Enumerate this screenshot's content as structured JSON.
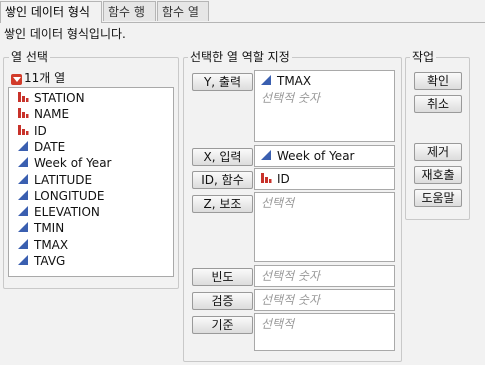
{
  "tabs": [
    {
      "label": "쌓인 데이터 형식"
    },
    {
      "label": "함수 행"
    },
    {
      "label": "함수 열"
    }
  ],
  "description": "쌓인 데이터 형식입니다.",
  "column_select": {
    "title": "열 선택",
    "count_label": "11개 열",
    "items": [
      {
        "label": "STATION",
        "type": "nominal"
      },
      {
        "label": "NAME",
        "type": "nominal"
      },
      {
        "label": "ID",
        "type": "nominal"
      },
      {
        "label": "DATE",
        "type": "continuous"
      },
      {
        "label": "Week of Year",
        "type": "continuous"
      },
      {
        "label": "LATITUDE",
        "type": "continuous"
      },
      {
        "label": "LONGITUDE",
        "type": "continuous"
      },
      {
        "label": "ELEVATION",
        "type": "continuous"
      },
      {
        "label": "TMIN",
        "type": "continuous"
      },
      {
        "label": "TMAX",
        "type": "continuous"
      },
      {
        "label": "TAVG",
        "type": "continuous"
      }
    ]
  },
  "roles": {
    "title": "선택한 열 역할 지정",
    "y": {
      "button": "Y, 출력",
      "value": "TMAX",
      "placeholder": "선택적 숫자"
    },
    "x": {
      "button": "X, 입력",
      "value": "Week of Year"
    },
    "id": {
      "button": "ID, 함수",
      "value": "ID"
    },
    "z": {
      "button": "Z, 보조",
      "placeholder": "선택적"
    },
    "freq": {
      "button": "빈도",
      "placeholder": "선택적 숫자"
    },
    "validation": {
      "button": "검증",
      "placeholder": "선택적 숫자"
    },
    "by": {
      "button": "기준",
      "placeholder": "선택적"
    }
  },
  "actions": {
    "title": "작업",
    "ok": "확인",
    "cancel": "취소",
    "remove": "제거",
    "recall": "재호출",
    "help": "도움말"
  },
  "colors": {
    "continuous_icon": "#3a5fb0",
    "nominal_icon": "#c8322a",
    "list_bg": "#ffffff",
    "panel_bg": "#f2f2f2"
  }
}
